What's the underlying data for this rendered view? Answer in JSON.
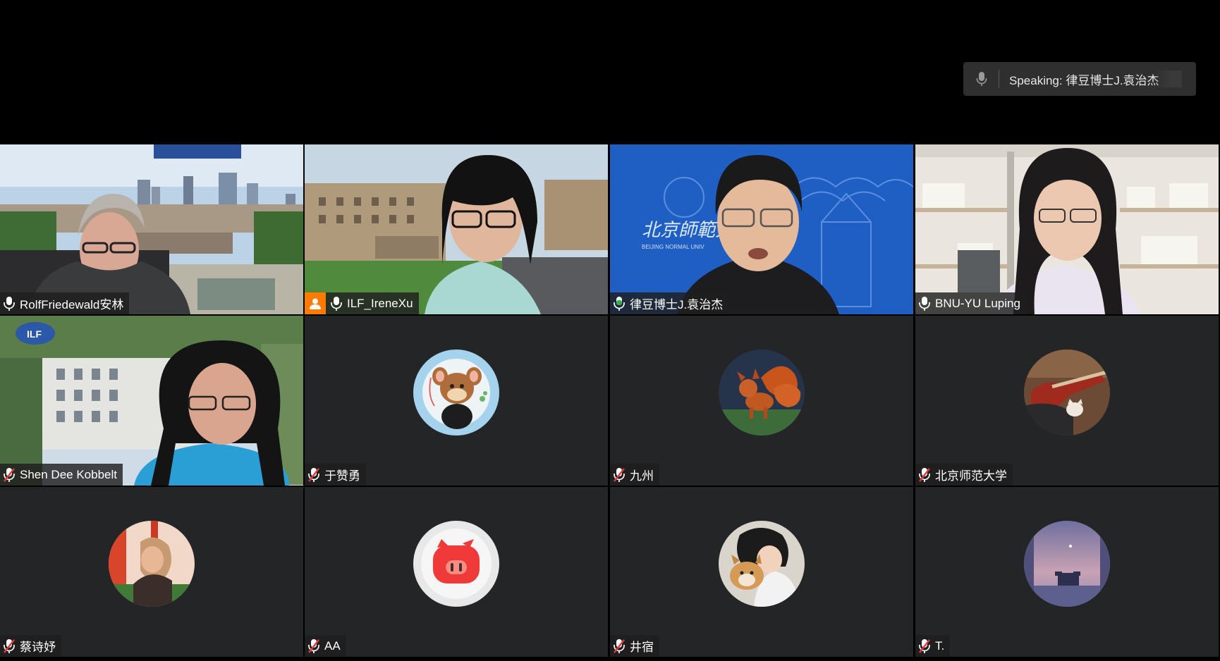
{
  "speaking": {
    "label": "Speaking: 律豆博士J.袁治杰"
  },
  "tiles": [
    {
      "name": "RolfFriedewald安林",
      "muted": false,
      "host": false,
      "video": true
    },
    {
      "name": "ILF_IreneXu",
      "muted": false,
      "host": true,
      "video": true
    },
    {
      "name": "律豆博士J.袁治杰",
      "muted": false,
      "host": false,
      "video": true,
      "speaking": true
    },
    {
      "name": "BNU-YU Luping",
      "muted": false,
      "host": false,
      "video": true
    },
    {
      "name": "Shen Dee Kobbelt",
      "muted": true,
      "host": false,
      "video": true
    },
    {
      "name": "于赞勇",
      "muted": true,
      "host": false,
      "video": false
    },
    {
      "name": "九州",
      "muted": true,
      "host": false,
      "video": false
    },
    {
      "name": "北京师范大学",
      "muted": true,
      "host": false,
      "video": false
    },
    {
      "name": "蔡诗妤",
      "muted": true,
      "host": false,
      "video": false
    },
    {
      "name": "AA",
      "muted": true,
      "host": false,
      "video": false
    },
    {
      "name": "井宿",
      "muted": true,
      "host": false,
      "video": false
    },
    {
      "name": "T.",
      "muted": true,
      "host": false,
      "video": false
    }
  ],
  "colors": {
    "active_border": "#2fb34a",
    "muted_mic": "#e0383b",
    "host_badge": "#ff7a00",
    "tile_bg": "#242527"
  }
}
